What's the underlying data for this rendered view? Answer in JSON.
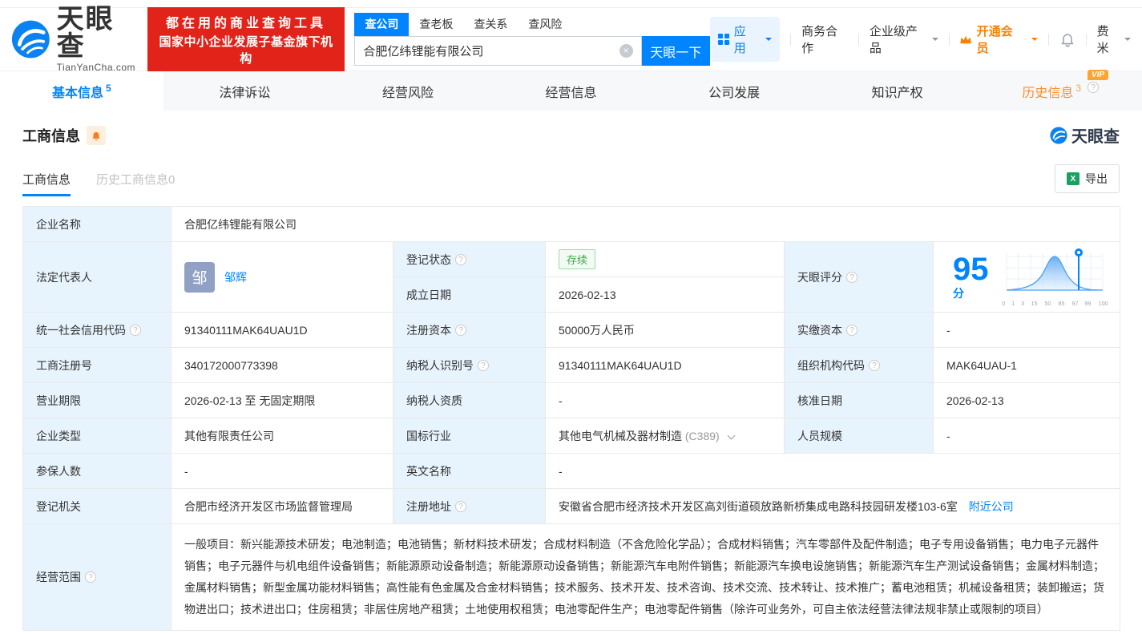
{
  "colors": {
    "accent": "#0084ff",
    "orange": "#ff8000",
    "promo_red": "#e2231a",
    "status_green": "#3fa848",
    "label_cell_bg": "#e8f4fd"
  },
  "icons": {
    "help": "?",
    "clear": "×",
    "excel": "X"
  },
  "header": {
    "logo": {
      "title": "天眼查",
      "subtitle": "TianYanCha.com"
    },
    "promo": {
      "line1": "都在用的商业查询工具",
      "line2": "国家中小企业发展子基金旗下机构"
    },
    "search": {
      "tabs": [
        "查公司",
        "查老板",
        "查关系",
        "查风险"
      ],
      "query": "合肥亿纬锂能有限公司",
      "button": "天眼一下"
    },
    "nav": {
      "apps": "应用",
      "coop": "商务合作",
      "enterprise": "企业级产品",
      "vip": "开通会员",
      "user": "费米"
    }
  },
  "tabs": {
    "vip_badge": "VIP",
    "items": [
      {
        "label": "基本信息",
        "count": "5"
      },
      {
        "label": "法律诉讼",
        "count": ""
      },
      {
        "label": "经营风险",
        "count": ""
      },
      {
        "label": "经营信息",
        "count": ""
      },
      {
        "label": "公司发展",
        "count": ""
      },
      {
        "label": "知识产权",
        "count": ""
      },
      {
        "label": "历史信息",
        "count": "3"
      }
    ]
  },
  "section": {
    "title": "工商信息",
    "subtabs": [
      "工商信息",
      "历史工商信息0"
    ],
    "export": "导出",
    "watermark": "天眼查"
  },
  "biz": {
    "company_name": {
      "label": "企业名称",
      "value": "合肥亿纬锂能有限公司"
    },
    "legal_rep": {
      "label": "法定代表人",
      "avatar": "邹",
      "name": "邹辉"
    },
    "reg_status": {
      "label": "登记状态",
      "value": "存续"
    },
    "establish_date": {
      "label": "成立日期",
      "value": "2026-02-13"
    },
    "score": {
      "label": "天眼评分",
      "value": "95",
      "unit": "分"
    },
    "credit_code": {
      "label": "统一社会信用代码",
      "value": "91340111MAK64UAU1D"
    },
    "reg_capital": {
      "label": "注册资本",
      "value": "50000万人民币"
    },
    "paid_capital": {
      "label": "实缴资本",
      "value": "-"
    },
    "reg_no": {
      "label": "工商注册号",
      "value": "340172000773398"
    },
    "taxpayer_id": {
      "label": "纳税人识别号",
      "value": "91340111MAK64UAU1D"
    },
    "org_code": {
      "label": "组织机构代码",
      "value": "MAK64UAU-1"
    },
    "term": {
      "label": "营业期限",
      "value": "2026-02-13 至 无固定期限"
    },
    "taxpayer_quality": {
      "label": "纳税人资质",
      "value": "-"
    },
    "approval_date": {
      "label": "核准日期",
      "value": "2026-02-13"
    },
    "company_type": {
      "label": "企业类型",
      "value": "其他有限责任公司"
    },
    "industry": {
      "label": "国标行业",
      "value": "其他电气机械及器材制造",
      "code": "(C389)"
    },
    "staff_size": {
      "label": "人员规模",
      "value": "-"
    },
    "insured": {
      "label": "参保人数",
      "value": "-"
    },
    "english_name": {
      "label": "英文名称",
      "value": "-"
    },
    "reg_authority": {
      "label": "登记机关",
      "value": "合肥市经济开发区市场监督管理局"
    },
    "address": {
      "label": "注册地址",
      "value": "安徽省合肥市经济技术开发区高刘街道硕放路新桥集成电路科技园研发楼103-6室",
      "nearby": "附近公司"
    },
    "scope": {
      "label": "经营范围",
      "value": "一般项目：新兴能源技术研发；电池制造；电池销售；新材料技术研发；合成材料制造（不含危险化学品）；合成材料销售；汽车零部件及配件制造；电子专用设备销售；电力电子元器件销售；电子元器件与机电组件设备销售；新能源原动设备制造；新能源原动设备销售；新能源汽车电附件销售；新能源汽车换电设施销售；新能源汽车生产测试设备销售；金属材料制造；金属材料销售；新型金属功能材料销售；高性能有色金属及合金材料销售；技术服务、技术开发、技术咨询、技术交流、技术转让、技术推广；蓄电池租赁；机械设备租赁；装卸搬运；货物进出口；技术进出口；住房租赁；非居住房地产租赁；土地使用权租赁；电池零配件生产；电池零配件销售（除许可业务外，可自主依法经营法律法规非禁止或限制的项目）"
    }
  },
  "chart_data": {
    "type": "area",
    "title": "天眼评分",
    "score": 95,
    "x_ticks": [
      "0",
      "1",
      "3",
      "15",
      "50",
      "85",
      "97",
      "99",
      "100"
    ],
    "marker_tick": "97",
    "grid": true
  }
}
